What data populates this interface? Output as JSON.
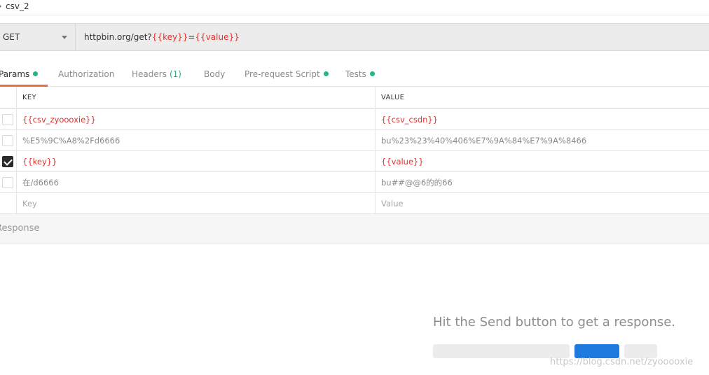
{
  "request": {
    "name": "csv_2",
    "method": "GET",
    "url_base": "httpbin.org/get?",
    "url_var_key": "{{key}}",
    "url_eq": "=",
    "url_var_value": "{{value}}"
  },
  "tabs": [
    {
      "label": "Params",
      "dot": true,
      "active": true
    },
    {
      "label": "Authorization"
    },
    {
      "label": "Headers",
      "count": "(1)"
    },
    {
      "label": "Body"
    },
    {
      "label": "Pre-request Script",
      "dot": true
    },
    {
      "label": "Tests",
      "dot": true
    }
  ],
  "params": {
    "header_key": "KEY",
    "header_value": "VALUE",
    "rows": [
      {
        "key": "{{csv_zyoooxie}}",
        "value": "{{csv_csdn}}",
        "checked": false,
        "style": "var"
      },
      {
        "key": "%E5%9C%A8%2Fd6666",
        "value": "bu%23%23%40%406%E7%9A%84%E7%9A%8466",
        "checked": false,
        "style": "plain"
      },
      {
        "key": "{{key}}",
        "value": "{{value}}",
        "checked": true,
        "style": "var"
      },
      {
        "key": "在/d6666",
        "value": "bu##@@6的的66",
        "checked": false,
        "style": "plain"
      }
    ],
    "placeholder_key": "Key",
    "placeholder_value": "Value"
  },
  "response": {
    "label": "Response",
    "empty_message": "Hit the Send button to get a response."
  },
  "watermark": "https://blog.csdn.net/zyooooxie",
  "colors": {
    "accent": "#f26b3a",
    "variable": "#e0322d",
    "dot": "#26b47f",
    "button_blue": "#1f7ae0"
  }
}
